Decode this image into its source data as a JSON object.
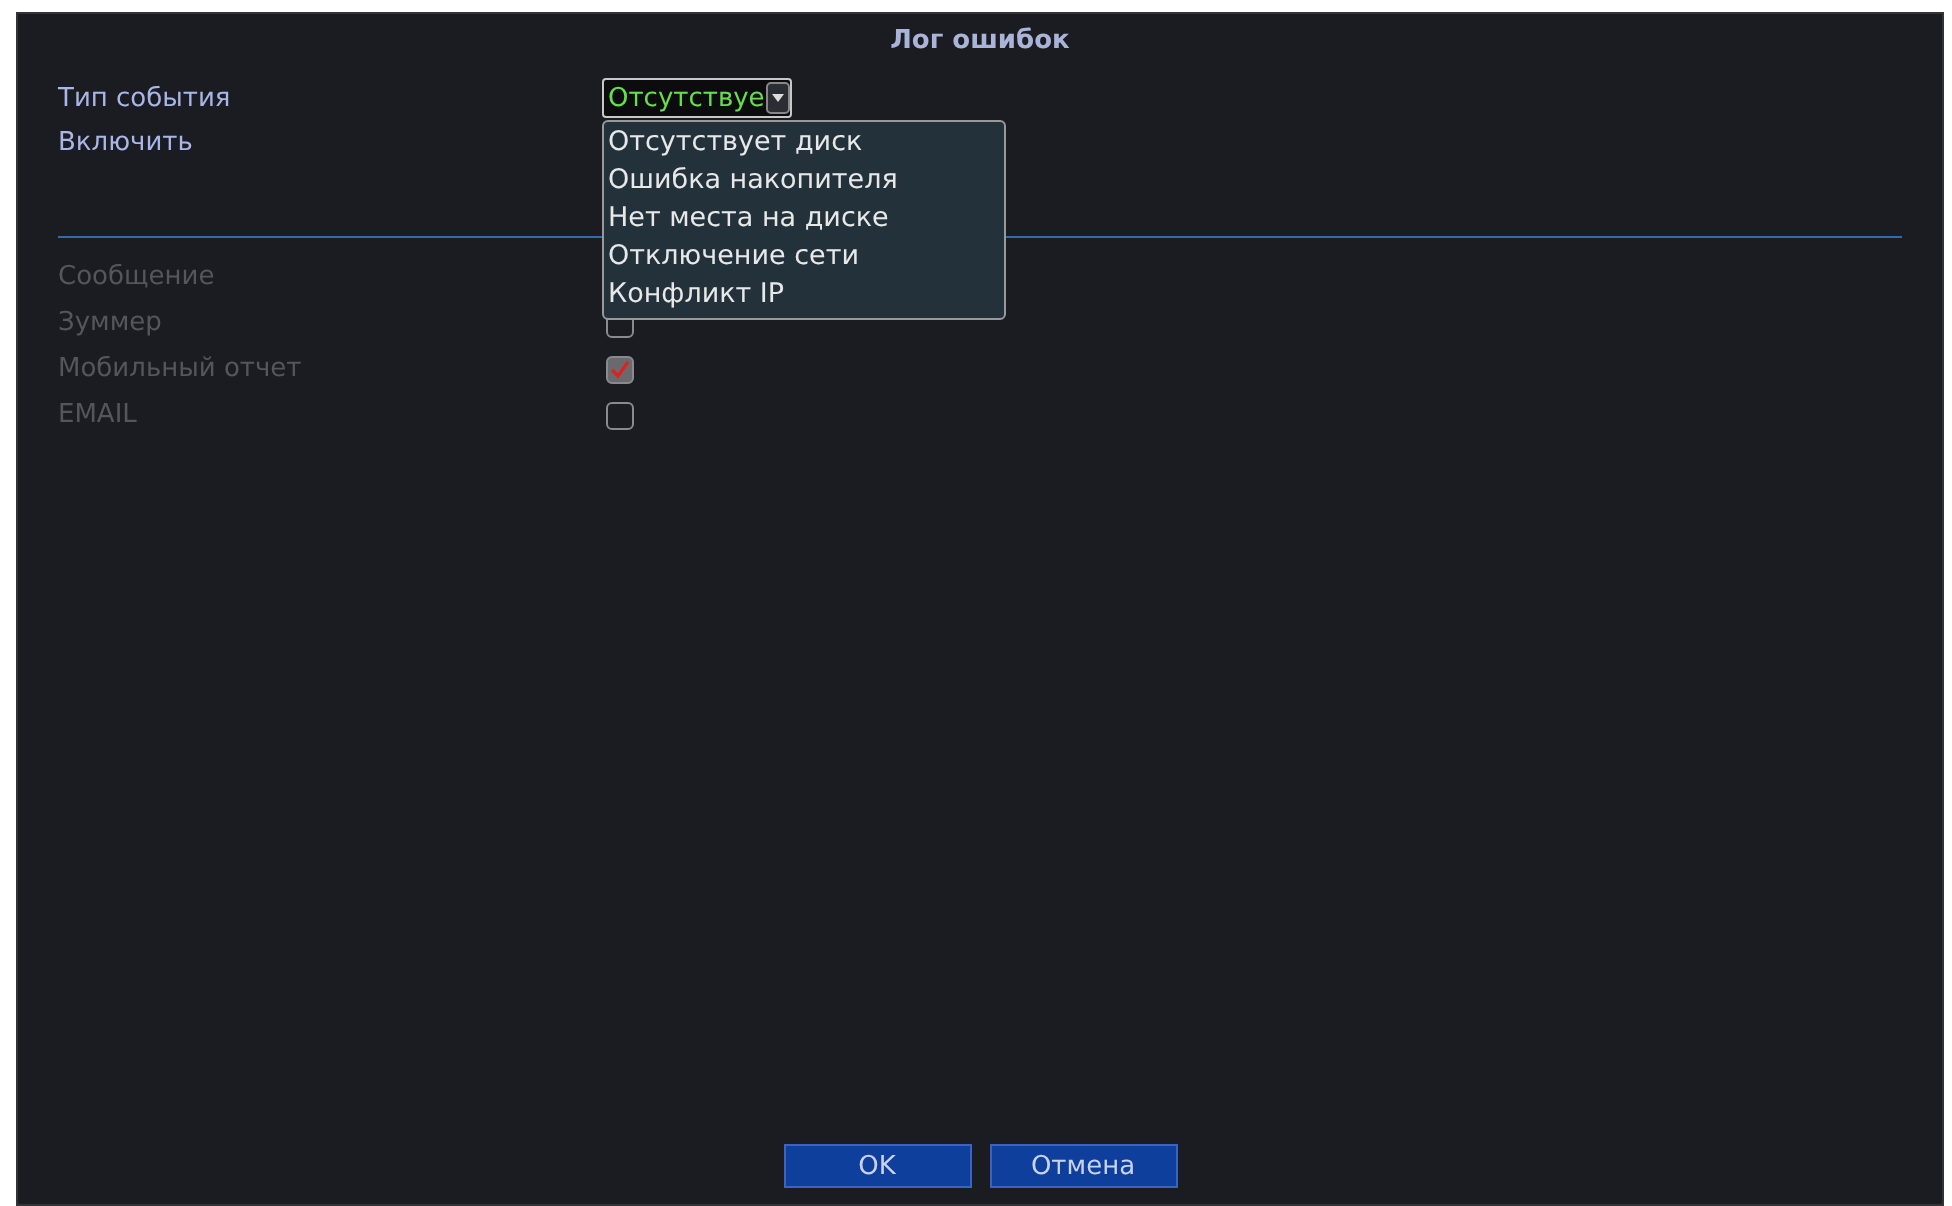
{
  "window": {
    "title": "Лог ошибок"
  },
  "event_type": {
    "label": "Тип события",
    "value": "Отсутствуе",
    "expanded": true,
    "options": [
      {
        "label": "Отсутствует диск"
      },
      {
        "label": "Ошибка накопителя"
      },
      {
        "label": "Нет места на диске"
      },
      {
        "label": "Отключение сети"
      },
      {
        "label": "Конфликт IP"
      }
    ]
  },
  "enable": {
    "label": "Включить"
  },
  "actions": [
    {
      "label": "Сообщение",
      "disabled": true
    },
    {
      "label": "Зуммер",
      "disabled": true,
      "checked": false
    },
    {
      "label": "Мобильный отчет",
      "disabled": true,
      "checked": true
    },
    {
      "label": "EMAIL",
      "disabled": true,
      "checked": false
    }
  ],
  "buttons": [
    {
      "label": "OK"
    },
    {
      "label": "Отмена"
    }
  ]
}
